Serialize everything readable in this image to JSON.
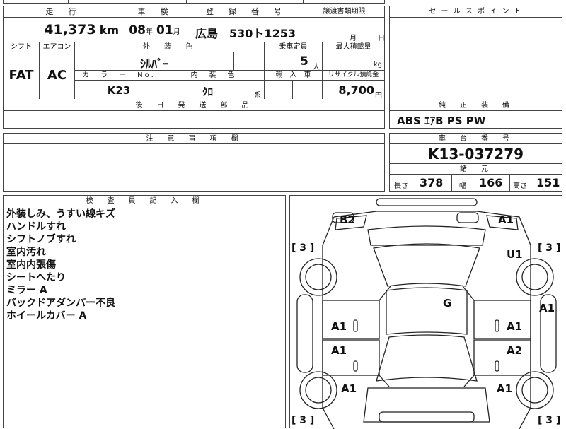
{
  "summary": {
    "mileage_label": "走　行",
    "mileage_value": "41,373",
    "mileage_unit": "km",
    "inspection_label": "車　検",
    "inspection_year": "08",
    "inspection_year_unit": "年",
    "inspection_month": "01",
    "inspection_month_unit": "月",
    "plate_label": "登　録　番　号",
    "plate_value": "広島　530ト1253",
    "transfer_label": "譲渡書類期限",
    "transfer_month_unit": "月",
    "transfer_day_unit": "日"
  },
  "specs": {
    "shift_label": "シフト",
    "shift_value": "FAT",
    "ac_label": "エアコン",
    "ac_value": "AC",
    "exterior_color_label": "外　装　色",
    "exterior_color_value": "ｼﾙﾊﾞｰ",
    "capacity_label": "乗車定員",
    "capacity_value": "5",
    "capacity_unit": "人",
    "max_load_label": "最大積載量",
    "max_load_unit": "kg",
    "color_no_label": "カ　ラ　ー　No.",
    "color_no_value": "K23",
    "interior_color_label": "内　装　色",
    "interior_color_value": "ｸﾛ",
    "interior_color_suffix": "系",
    "import_label": "輸　入　車",
    "recycle_label": "リサイクル預託金",
    "recycle_value": "8,700",
    "recycle_unit": "円"
  },
  "later_parts_label": "後　日　発　送　部　品",
  "sales_point_label": "セ ー ル ス ポ イ ン ト",
  "genuine_equipment": {
    "label": "純　正　装　備",
    "value": "ABS ｴｱB PS PW"
  },
  "caution_label": "注　意　事　項　欄",
  "chassis": {
    "label": "車　台　番　号",
    "value": "K13-037279"
  },
  "dimensions": {
    "label": "諸　元",
    "length_label": "長さ",
    "length_value": "378",
    "width_label": "幅",
    "width_value": "166",
    "height_label": "高さ",
    "height_value": "151"
  },
  "inspector": {
    "label": "検　査　員　記　入　欄",
    "notes": [
      "外装しみ、うすい線キズ",
      "ハンドルすれ",
      "シフトノブすれ",
      "室内汚れ",
      "室内内張傷",
      "シートへたり",
      "ミラー A",
      "バックドアダンパー不良",
      "ホイールカバー A"
    ]
  },
  "diagram": {
    "marks": {
      "b2": "B2",
      "a1_top_right": "A1",
      "u1": "U1",
      "g": "G",
      "a1_right_edge": "A1",
      "a1_left_front_door": "A1",
      "a1_right_front_door": "A1",
      "a1_left_rear_door": "A1",
      "a2_right_rear_door": "A2",
      "a1_left_rear": "A1",
      "a1_right_rear": "A1"
    },
    "tires": {
      "front_left": "[ 3 ]",
      "front_right": "[ 3 ]",
      "rear_left": "[ 3 ]",
      "rear_right": "[ 3 ]"
    }
  }
}
